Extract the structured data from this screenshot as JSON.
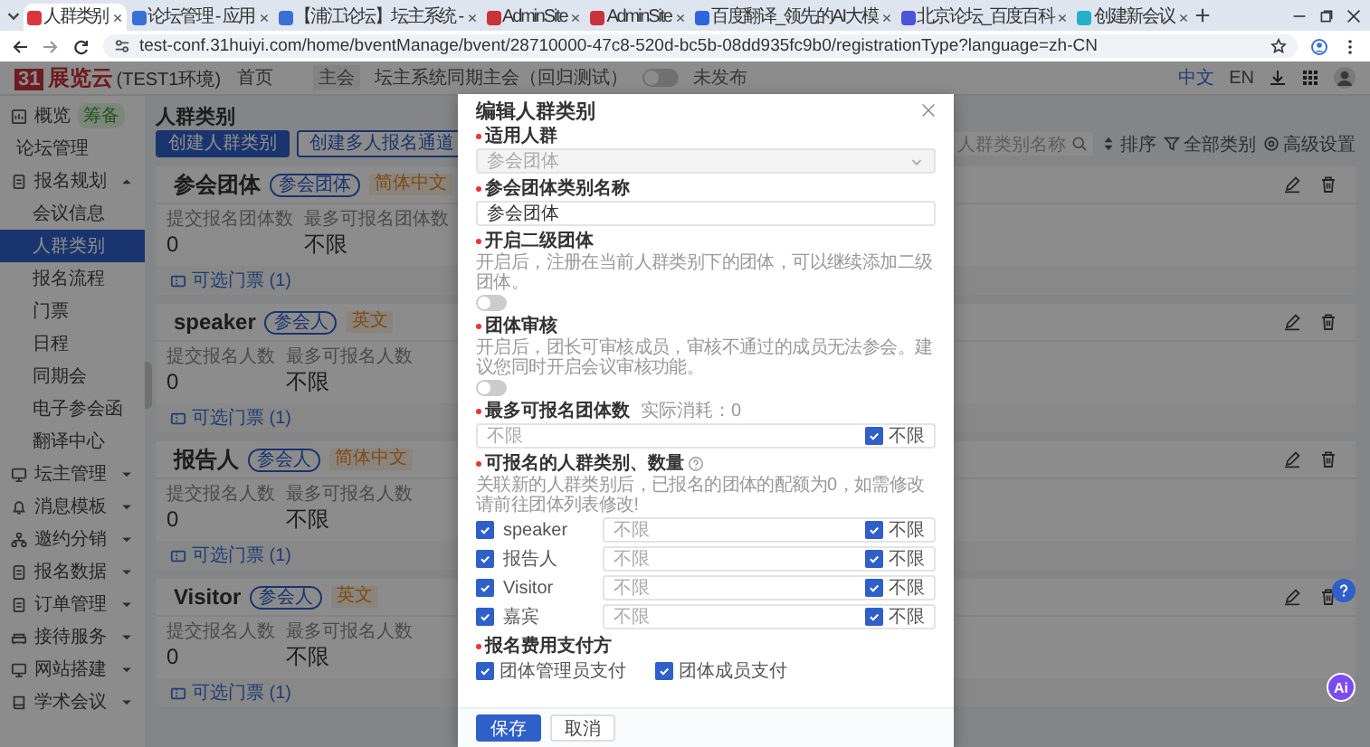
{
  "browser": {
    "tabs": [
      {
        "title": "人群类别",
        "selected": true,
        "color": "#d9363e"
      },
      {
        "title": "论坛管理 - 应用",
        "selected": false,
        "color": "#3b6fd8"
      },
      {
        "title": "【浦江论坛】坛主系统 -",
        "selected": false,
        "color": "#3b6fd8"
      },
      {
        "title": "AdminSite",
        "selected": false,
        "color": "#c8323a"
      },
      {
        "title": "AdminSite",
        "selected": false,
        "color": "#c8323a"
      },
      {
        "title": "百度翻译_领先的AI大模",
        "selected": false,
        "color": "#2b66e0"
      },
      {
        "title": "北京论坛_百度百科",
        "selected": false,
        "color": "#4a55d8"
      },
      {
        "title": "创建新会议",
        "selected": false,
        "color": "#22b0c8"
      }
    ],
    "url": "test-conf.31huiyi.com/home/bventManage/bvent/28710000-47c8-520d-bc5b-08dd935fc9b0/registrationType?language=zh-CN"
  },
  "header": {
    "logo_mark": "31",
    "logo_text": "展览云",
    "env": "(TEST1环境)",
    "nav": "首页",
    "conf_tag": "主会",
    "conf_name": "坛主系统同期主会（回归测试）",
    "published": false,
    "publish_label": "未发布",
    "langs": [
      {
        "label": "中文",
        "selected": true
      },
      {
        "label": "EN",
        "selected": false
      }
    ]
  },
  "sidebar": {
    "items": [
      {
        "label": "概览",
        "badge": "筹备",
        "selected": false
      },
      {
        "label": "论坛管理",
        "selected": false
      },
      {
        "label": "报名规划",
        "selected": false,
        "expanded": true,
        "children": [
          {
            "label": "会议信息",
            "selected": false
          },
          {
            "label": "人群类别",
            "selected": true
          },
          {
            "label": "报名流程",
            "selected": false
          },
          {
            "label": "门票",
            "selected": false
          },
          {
            "label": "日程",
            "selected": false
          },
          {
            "label": "同期会",
            "selected": false
          },
          {
            "label": "电子参会函",
            "selected": false
          },
          {
            "label": "翻译中心",
            "selected": false
          }
        ]
      },
      {
        "label": "坛主管理",
        "selected": false,
        "expanded": false
      },
      {
        "label": "消息模板",
        "selected": false,
        "expanded": false
      },
      {
        "label": "邀约分销",
        "selected": false,
        "expanded": false
      },
      {
        "label": "报名数据",
        "selected": false,
        "expanded": false
      },
      {
        "label": "订单管理",
        "selected": false,
        "expanded": false
      },
      {
        "label": "接待服务",
        "selected": false,
        "expanded": false
      },
      {
        "label": "网站搭建",
        "selected": false,
        "expanded": false
      },
      {
        "label": "学术会议",
        "selected": false,
        "expanded": false
      }
    ]
  },
  "page": {
    "title": "人群类别",
    "buttons": [
      {
        "label": "创建人群类别",
        "kind": "primary"
      },
      {
        "label": "创建多人报名通道",
        "kind": "outline"
      }
    ],
    "search": {
      "placeholder": "人群类别名称"
    },
    "tools": [
      "排序",
      "全部类别",
      "高级设置"
    ],
    "cards": [
      {
        "title": "参会团体",
        "type_tag": "参会团体",
        "lang_tag": "简体中文",
        "stats": [
          {
            "label": "提交报名团体数",
            "value": "0"
          },
          {
            "label": "最多可报名团体数",
            "value": "不限"
          }
        ],
        "link": "可选门票 (1)"
      },
      {
        "title": "speaker",
        "type_tag": "参会人",
        "lang_tag": "英文",
        "stats": [
          {
            "label": "提交报名人数",
            "value": "0"
          },
          {
            "label": "最多可报名人数",
            "value": "不限"
          }
        ],
        "link": "可选门票 (1)"
      },
      {
        "title": "报告人",
        "type_tag": "参会人",
        "lang_tag": "简体中文",
        "stats": [
          {
            "label": "提交报名人数",
            "value": "0"
          },
          {
            "label": "最多可报名人数",
            "value": "不限"
          }
        ],
        "link": "可选门票 (1)"
      },
      {
        "title": "Visitor",
        "type_tag": "参会人",
        "lang_tag": "英文",
        "stats": [
          {
            "label": "提交报名人数",
            "value": "0"
          },
          {
            "label": "最多可报名人数",
            "value": "不限"
          }
        ],
        "link": "可选门票 (1)"
      }
    ],
    "ai_button": "Ai"
  },
  "modal": {
    "title": "编辑人群类别",
    "audience": {
      "label": "适用人群",
      "value": "参会团体",
      "disabled": true
    },
    "name": {
      "label": "参会团体类别名称",
      "value": "参会团体"
    },
    "switches": [
      {
        "label": "开启二级团体",
        "hint": "开启后，注册在当前人群类别下的团体，可以继续添加二级团体。",
        "on": false
      },
      {
        "label": "团体审核",
        "hint": "开启后，团长可审核成员，审核不通过的成员无法参会。建议您同时开启会议审核功能。",
        "on": false
      }
    ],
    "max_groups": {
      "label": "最多可报名团体数",
      "note": "实际消耗：0",
      "placeholder": "不限",
      "unlimited": true,
      "unlimited_label": "不限"
    },
    "quota": {
      "label": "可报名的人群类别、数量",
      "hint": "关联新的人群类别后，已报名的团体的配额为0，如需修改请前往团体列表修改!",
      "rows": [
        {
          "name": "speaker",
          "checked": true,
          "placeholder": "不限",
          "unlimited": true,
          "unlimited_label": "不限"
        },
        {
          "name": "报告人",
          "checked": true,
          "placeholder": "不限",
          "unlimited": true,
          "unlimited_label": "不限"
        },
        {
          "name": "Visitor",
          "checked": true,
          "placeholder": "不限",
          "unlimited": true,
          "unlimited_label": "不限"
        },
        {
          "name": "嘉宾",
          "checked": true,
          "placeholder": "不限",
          "unlimited": true,
          "unlimited_label": "不限"
        }
      ]
    },
    "payment": {
      "label": "报名费用支付方",
      "options": [
        {
          "label": "团体管理员支付",
          "checked": true
        },
        {
          "label": "团体成员支付",
          "checked": true
        }
      ]
    },
    "buttons": [
      {
        "label": "保存",
        "kind": "primary"
      },
      {
        "label": "取消",
        "kind": "default"
      }
    ]
  }
}
